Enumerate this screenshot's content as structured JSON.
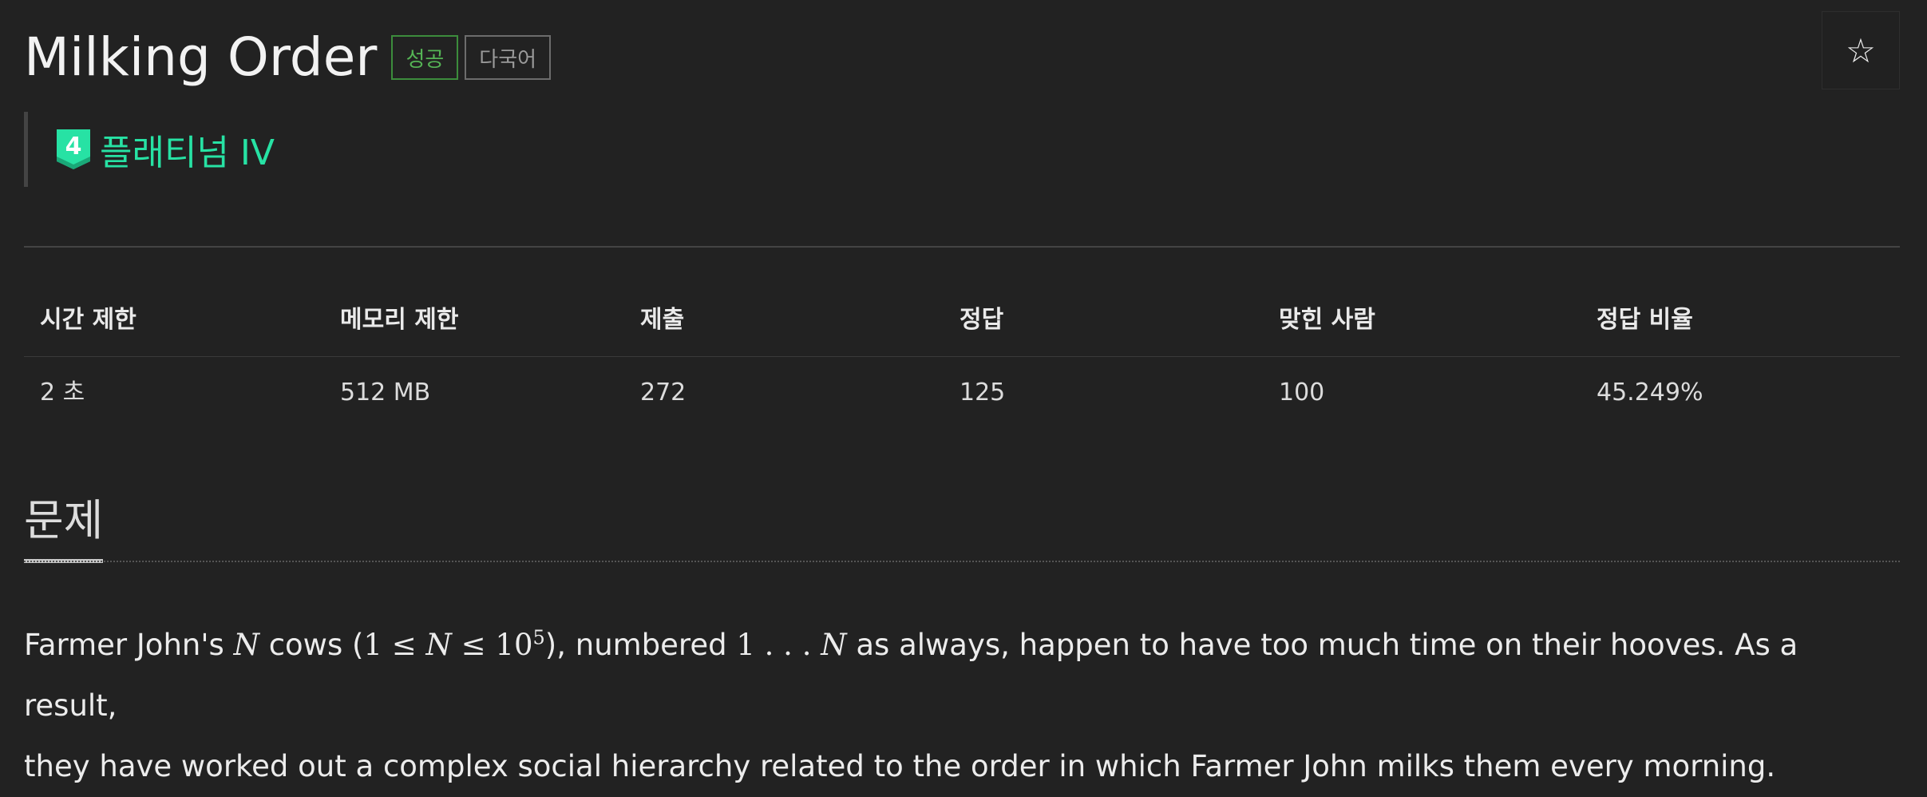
{
  "problem": {
    "title": "Milking Order",
    "badge_status": "성공",
    "badge_language": "다국어",
    "tier": {
      "number": "4",
      "label": "플래티넘 IV",
      "color": "#27e2a4"
    },
    "star_icon": "star-icon"
  },
  "stats": {
    "headers": [
      "시간 제한",
      "메모리 제한",
      "제출",
      "정답",
      "맞힌 사람",
      "정답 비율"
    ],
    "values": [
      "2 초",
      "512 MB",
      "272",
      "125",
      "100",
      "45.249%"
    ]
  },
  "section": {
    "title": "문제"
  },
  "statement": {
    "line1_prefix": "Farmer John's ",
    "var_N": "N",
    "cows": " cows (",
    "one": "1",
    "leq": " ≤ ",
    "ten": "10",
    "exp": "5",
    "numbered": "), numbered ",
    "range_start": "1",
    "dots": " . . . ",
    "rest1": " as always, happen to have too much time on their hooves. As a result,",
    "line2": "they have worked out a complex social hierarchy related to the order in which Farmer John milks them every morning."
  },
  "colors": {
    "background": "#222222",
    "success_badge": "#55b455",
    "tier": "#27e2a4"
  }
}
